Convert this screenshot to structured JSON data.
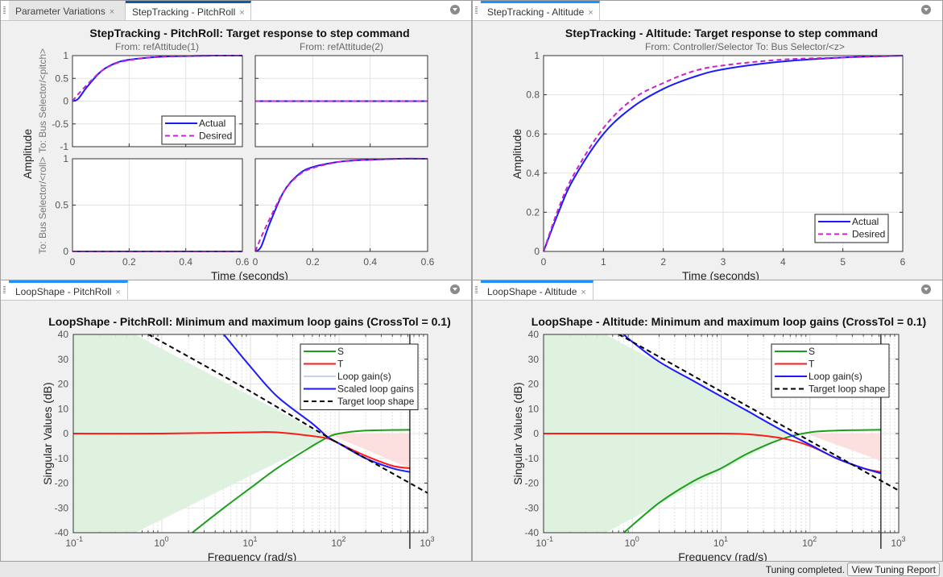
{
  "panels": {
    "top_left": {
      "tabs": [
        {
          "label": "Parameter Variations",
          "active": false
        },
        {
          "label": "StepTracking - PitchRoll",
          "active": true
        }
      ],
      "title": "StepTracking - PitchRoll: Target response to step command",
      "col_labels": [
        "From: refAttitude(1)",
        "From: refAttitude(2)"
      ],
      "row_labels": [
        "To: Bus Selector/<pitch>",
        "To: Bus Selector/<roll>"
      ],
      "ylabel": "Amplitude",
      "xlabel": "Time (seconds)"
    },
    "top_right": {
      "tabs": [
        {
          "label": "StepTracking - Altitude",
          "active": true
        }
      ],
      "title": "StepTracking - Altitude: Target response to step command",
      "subtitle": "From: Controller/Selector  To: Bus Selector/<z>",
      "ylabel": "Amplitude",
      "xlabel": "Time (seconds)"
    },
    "bottom_left": {
      "tabs": [
        {
          "label": "LoopShape - PitchRoll",
          "active": true
        }
      ],
      "title": "LoopShape - PitchRoll: Minimum and maximum loop gains (CrossTol = 0.1)",
      "ylabel": "Singular Values (dB)",
      "xlabel": "Frequency (rad/s)"
    },
    "bottom_right": {
      "tabs": [
        {
          "label": "LoopShape - Altitude",
          "active": true
        }
      ],
      "title": "LoopShape - Altitude: Minimum and maximum loop gains (CrossTol = 0.1)",
      "ylabel": "Singular Values (dB)",
      "xlabel": "Frequency (rad/s)"
    }
  },
  "close_glyph": "×",
  "status": {
    "text": "Tuning completed.",
    "button": "View Tuning Report"
  },
  "colors": {
    "actual": "#1a1aff",
    "desired": "#cc22cc",
    "S": "#1a9f1a",
    "T": "#ff1a1a",
    "loop_gain_light": "#c8d0f0",
    "scaled_loop": "#1a1aff",
    "target": "#000000",
    "green_fill": "#dcf0dc",
    "red_fill": "#fcdcdc"
  },
  "chart_data": [
    {
      "id": "pitchroll-step",
      "type": "line",
      "title": "StepTracking - PitchRoll: Target response to step command",
      "xlabel": "Time (seconds)",
      "ylabel": "Amplitude",
      "xlim": [
        0,
        0.6
      ],
      "xticks": [
        "0",
        "0.2",
        "0.4",
        "0.6"
      ],
      "grid": true,
      "legend": {
        "entries": [
          "Actual",
          "Desired"
        ],
        "placement": "bottom-right of subplot (1,1)"
      },
      "subplots": [
        {
          "row": 1,
          "col": 1,
          "ylim": [
            -1,
            1
          ],
          "yticks": [
            "1",
            "0.5",
            "0",
            "-0.5",
            "-1"
          ],
          "series": [
            {
              "name": "Actual",
              "x": [
                0,
                0.02,
                0.05,
                0.1,
                0.15,
                0.2,
                0.3,
                0.4,
                0.5,
                0.6
              ],
              "values": [
                0,
                0.05,
                0.3,
                0.65,
                0.83,
                0.91,
                0.97,
                0.99,
                1.0,
                1.0
              ]
            },
            {
              "name": "Desired",
              "x": [
                0,
                0.02,
                0.05,
                0.1,
                0.15,
                0.2,
                0.3,
                0.4,
                0.5,
                0.6
              ],
              "values": [
                0,
                0.15,
                0.35,
                0.65,
                0.82,
                0.9,
                0.97,
                0.99,
                1.0,
                1.0
              ]
            }
          ]
        },
        {
          "row": 1,
          "col": 2,
          "ylim": [
            -1,
            1
          ],
          "series": [
            {
              "name": "Actual",
              "x": [
                0,
                0.6
              ],
              "values": [
                0,
                0
              ]
            },
            {
              "name": "Desired",
              "x": [
                0,
                0.6
              ],
              "values": [
                0,
                0
              ]
            }
          ]
        },
        {
          "row": 2,
          "col": 1,
          "ylim": [
            0,
            1
          ],
          "yticks": [
            "1",
            "0.5",
            "0"
          ],
          "series": [
            {
              "name": "Actual",
              "x": [
                0,
                0.6
              ],
              "values": [
                0,
                0
              ]
            },
            {
              "name": "Desired",
              "x": [
                0,
                0.6
              ],
              "values": [
                0,
                0
              ]
            }
          ]
        },
        {
          "row": 2,
          "col": 2,
          "ylim": [
            0,
            1
          ],
          "series": [
            {
              "name": "Actual",
              "x": [
                0,
                0.02,
                0.05,
                0.1,
                0.15,
                0.2,
                0.3,
                0.4,
                0.5,
                0.6
              ],
              "values": [
                0,
                0.05,
                0.3,
                0.65,
                0.83,
                0.91,
                0.97,
                0.99,
                1.0,
                1.0
              ]
            },
            {
              "name": "Desired",
              "x": [
                0,
                0.02,
                0.05,
                0.1,
                0.15,
                0.2,
                0.3,
                0.4,
                0.5,
                0.6
              ],
              "values": [
                0,
                0.15,
                0.35,
                0.65,
                0.82,
                0.9,
                0.97,
                0.99,
                1.0,
                1.0
              ]
            }
          ]
        }
      ]
    },
    {
      "id": "altitude-step",
      "type": "line",
      "title": "StepTracking - Altitude: Target response to step command",
      "subtitle": "From: Controller/Selector  To: Bus Selector/<z>",
      "xlabel": "Time (seconds)",
      "ylabel": "Amplitude",
      "xlim": [
        0,
        6
      ],
      "ylim": [
        0,
        1
      ],
      "xticks": [
        "0",
        "1",
        "2",
        "3",
        "4",
        "5",
        "6"
      ],
      "yticks": [
        "0",
        "0.2",
        "0.4",
        "0.6",
        "0.8",
        "1"
      ],
      "grid": true,
      "legend": {
        "entries": [
          "Actual",
          "Desired"
        ],
        "placement": "bottom-right"
      },
      "series": [
        {
          "name": "Actual",
          "x": [
            0,
            0.25,
            0.5,
            1,
            1.5,
            2,
            2.5,
            3,
            4,
            5,
            6
          ],
          "values": [
            0,
            0.2,
            0.37,
            0.6,
            0.74,
            0.83,
            0.89,
            0.93,
            0.97,
            0.99,
            1.0
          ]
        },
        {
          "name": "Desired",
          "x": [
            0,
            0.25,
            0.5,
            1,
            1.5,
            2,
            2.5,
            3,
            4,
            5,
            6
          ],
          "values": [
            0,
            0.22,
            0.39,
            0.63,
            0.78,
            0.86,
            0.92,
            0.95,
            0.98,
            0.99,
            1.0
          ]
        }
      ]
    },
    {
      "id": "pitchroll-loopshape",
      "type": "line",
      "xscale": "log",
      "title": "LoopShape - PitchRoll: Minimum and maximum loop gains (CrossTol = 0.1)",
      "xlabel": "Frequency (rad/s)",
      "ylabel": "Singular Values (dB)",
      "xlim": [
        0.1,
        1000
      ],
      "ylim": [
        -40,
        40
      ],
      "xticks": [
        "10^-1",
        "10^0",
        "10^1",
        "10^2",
        "10^3"
      ],
      "yticks": [
        "40",
        "30",
        "20",
        "10",
        "0",
        "-10",
        "-20",
        "-30",
        "-40"
      ],
      "grid": true,
      "nyquist_line": 630,
      "legend": {
        "entries": [
          "S",
          "T",
          "Loop gain(s)",
          "Scaled loop gains",
          "Target loop shape"
        ],
        "placement": "top-right"
      },
      "series": [
        {
          "name": "S",
          "x": [
            2.2,
            5,
            10,
            20,
            50,
            75,
            100,
            200,
            630
          ],
          "values": [
            -40,
            -30,
            -22,
            -14,
            -5,
            -1.5,
            0,
            1.2,
            1.5
          ]
        },
        {
          "name": "T",
          "x": [
            0.1,
            1,
            10,
            20,
            50,
            75,
            100,
            200,
            400,
            630
          ],
          "values": [
            0,
            0,
            0.5,
            0.5,
            -1,
            -2,
            -4,
            -9,
            -13,
            -14
          ]
        },
        {
          "name": "Scaled loop gains",
          "x": [
            5,
            10,
            20,
            50,
            75,
            100,
            200,
            400,
            630
          ],
          "values": [
            40,
            27,
            15,
            4,
            -1.5,
            -4,
            -10,
            -14,
            -15.5
          ]
        },
        {
          "name": "Target loop shape",
          "x": [
            0.7,
            1,
            10,
            75,
            100,
            1000
          ],
          "values": [
            40,
            37,
            17,
            -1.5,
            -4,
            -24
          ]
        }
      ],
      "regions": [
        {
          "name": "S bound (green)",
          "x": [
            0.1,
            0.5,
            75,
            0.5,
            0.1
          ],
          "values": [
            40,
            40,
            -1.5,
            -40,
            -40
          ]
        },
        {
          "name": "T bound (red)",
          "x": [
            75,
            630,
            630
          ],
          "values": [
            0,
            0,
            -14
          ]
        }
      ]
    },
    {
      "id": "altitude-loopshape",
      "type": "line",
      "xscale": "log",
      "title": "LoopShape - Altitude: Minimum and maximum loop gains (CrossTol = 0.1)",
      "xlabel": "Frequency (rad/s)",
      "ylabel": "Singular Values (dB)",
      "xlim": [
        0.1,
        1000
      ],
      "ylim": [
        -40,
        40
      ],
      "xticks": [
        "10^-1",
        "10^0",
        "10^1",
        "10^2",
        "10^3"
      ],
      "yticks": [
        "40",
        "30",
        "20",
        "10",
        "0",
        "-10",
        "-20",
        "-30",
        "-40"
      ],
      "grid": true,
      "nyquist_line": 630,
      "legend": {
        "entries": [
          "S",
          "T",
          "Loop gain(s)",
          "Target loop shape"
        ],
        "placement": "top-right"
      },
      "series": [
        {
          "name": "S",
          "x": [
            0.8,
            2,
            5,
            10,
            20,
            50,
            100,
            200,
            630
          ],
          "values": [
            -40,
            -28,
            -19,
            -14,
            -8,
            -2,
            0.5,
            1.2,
            1.5
          ]
        },
        {
          "name": "T",
          "x": [
            0.1,
            1,
            10,
            20,
            50,
            100,
            200,
            400,
            630
          ],
          "values": [
            0,
            0,
            0,
            -0.3,
            -2,
            -5,
            -10,
            -14,
            -15.5
          ]
        },
        {
          "name": "Loop gain(s)",
          "x": [
            0.8,
            1,
            2,
            5,
            10,
            20,
            50,
            100,
            200,
            400,
            630
          ],
          "values": [
            40,
            37,
            29,
            21,
            15,
            9,
            1,
            -4.5,
            -10,
            -14,
            -16
          ]
        },
        {
          "name": "Target loop shape",
          "x": [
            0.7,
            1,
            10,
            100,
            1000
          ],
          "values": [
            40,
            37,
            17,
            -3,
            -23
          ]
        }
      ],
      "regions": [
        {
          "name": "S bound (green)",
          "x": [
            0.1,
            0.5,
            60,
            0.5,
            0.1
          ],
          "values": [
            40,
            40,
            0,
            -40,
            -40
          ]
        },
        {
          "name": "T bound (red)",
          "x": [
            90,
            630,
            630
          ],
          "values": [
            0,
            0,
            -11
          ]
        }
      ]
    }
  ]
}
